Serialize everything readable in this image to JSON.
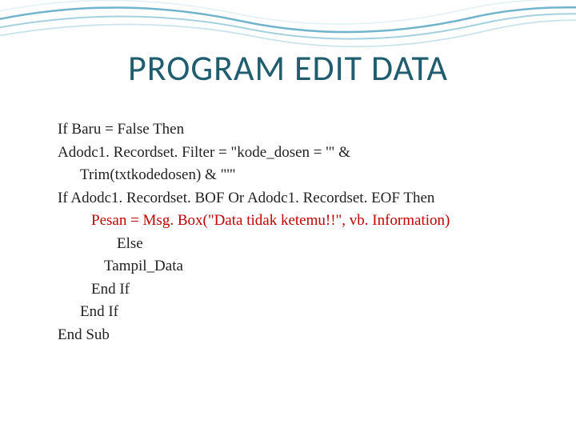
{
  "title": "PROGRAM EDIT DATA",
  "code": {
    "l1": "If Baru = False Then",
    "l2a": "Adodc1. Recordset. Filter = \"kode_dosen = '\" &",
    "l2b": "Trim(txtkodedosen) & \"'\"",
    "l3": "If Adodc1. Recordset. BOF Or Adodc1. Recordset. EOF Then",
    "l4": "Pesan = Msg. Box(\"Data tidak ketemu!!\", vb. Information)",
    "l5": "Else",
    "l6": "Tampil_Data",
    "l7": "End If",
    "l8": "End If",
    "l9": "End Sub"
  }
}
